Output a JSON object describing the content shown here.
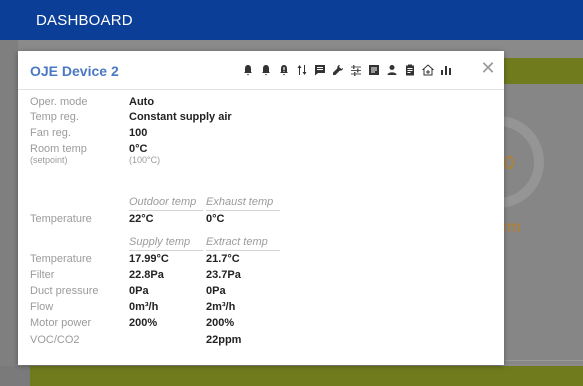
{
  "app": {
    "title": "DASHBOARD"
  },
  "background": {
    "gauge_value": "0",
    "alarm_text": "rm"
  },
  "modal": {
    "title": "OJE Device 2",
    "close_symbol": "✕",
    "toolbar_icons": [
      "bell-icon",
      "bell-icon",
      "bell-alert-icon",
      "sort-arrows-icon",
      "message-icon",
      "wrench-icon",
      "sliders-icon",
      "list-icon",
      "user-icon",
      "clipboard-icon",
      "home-plus-icon",
      "bar-chart-icon"
    ],
    "status": {
      "oper_mode_label": "Oper. mode",
      "oper_mode_value": "Auto",
      "temp_reg_label": "Temp reg.",
      "temp_reg_value": "Constant supply air",
      "fan_reg_label": "Fan reg.",
      "fan_reg_value": "100",
      "room_temp_label": "Room temp",
      "room_temp_sub_label": "(setpoint)",
      "room_temp_value": "0°C",
      "room_temp_sub_value": "(100°C)"
    },
    "outdoor": {
      "col1_header": "Outdoor temp",
      "col2_header": "Exhaust temp",
      "row_label": "Temperature",
      "col1_value": "22°C",
      "col2_value": "0°C"
    },
    "supply": {
      "col1_header": "Supply temp",
      "col2_header": "Extract temp",
      "rows": [
        {
          "label": "Temperature",
          "col1": "17.99°C",
          "col2": "21.7°C"
        },
        {
          "label": "Filter",
          "col1": "22.8Pa",
          "col2": "23.7Pa"
        },
        {
          "label": "Duct pressure",
          "col1": "0Pa",
          "col2": "0Pa"
        },
        {
          "label": "Flow",
          "col1": "0m³/h",
          "col2": "2m³/h"
        },
        {
          "label": "Motor power",
          "col1": "200%",
          "col2": "200%"
        },
        {
          "label": "VOC/CO2",
          "col1": "",
          "col2": "22ppm"
        }
      ]
    }
  }
}
